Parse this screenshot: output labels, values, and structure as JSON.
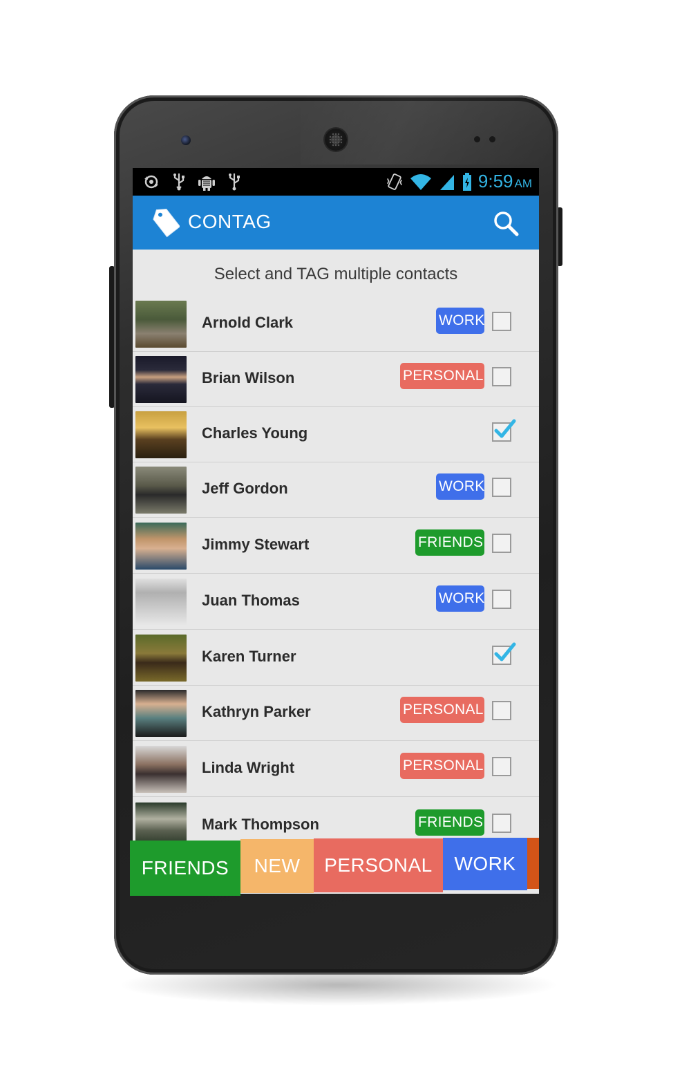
{
  "status_bar": {
    "left_icons": [
      "sync-icon",
      "usb-icon",
      "android-debug-icon",
      "usb-icon"
    ],
    "right_icons": [
      "vibrate-icon",
      "wifi-icon",
      "signal-icon",
      "battery-icon"
    ],
    "time": "9:59",
    "ampm": "AM",
    "time_color": "#33b5e5"
  },
  "app_bar": {
    "title": "CONTAG",
    "logo_icon": "tag-icon",
    "search_icon": "search-icon",
    "color": "#1d83d4"
  },
  "subtitle": "Select and TAG multiple contacts",
  "contacts": [
    {
      "name": "Arnold Clark",
      "tag": "WORK",
      "checked": false
    },
    {
      "name": "Brian Wilson",
      "tag": "PERSONAL",
      "checked": false
    },
    {
      "name": "Charles Young",
      "tag": "",
      "checked": true
    },
    {
      "name": "Jeff Gordon",
      "tag": "WORK",
      "checked": false
    },
    {
      "name": "Jimmy Stewart",
      "tag": "FRIENDS",
      "checked": false
    },
    {
      "name": "Juan Thomas",
      "tag": "WORK",
      "checked": false
    },
    {
      "name": "Karen Turner",
      "tag": "",
      "checked": true
    },
    {
      "name": "Kathryn Parker",
      "tag": "PERSONAL",
      "checked": false
    },
    {
      "name": "Linda Wright",
      "tag": "PERSONAL",
      "checked": false
    },
    {
      "name": "Mark Thompson",
      "tag": "FRIENDS",
      "checked": false
    }
  ],
  "tag_bar": [
    {
      "label": "FRIENDS",
      "color": "#1e9b2c"
    },
    {
      "label": "NEW",
      "color": "#f5b66a"
    },
    {
      "label": "PERSONAL",
      "color": "#e86b60"
    },
    {
      "label": "WORK",
      "color": "#3f6fea"
    },
    {
      "label": "",
      "color": "#d35418"
    }
  ],
  "tag_colors": {
    "WORK": "#3f6fea",
    "PERSONAL": "#e86b60",
    "FRIENDS": "#1e9b2c"
  }
}
